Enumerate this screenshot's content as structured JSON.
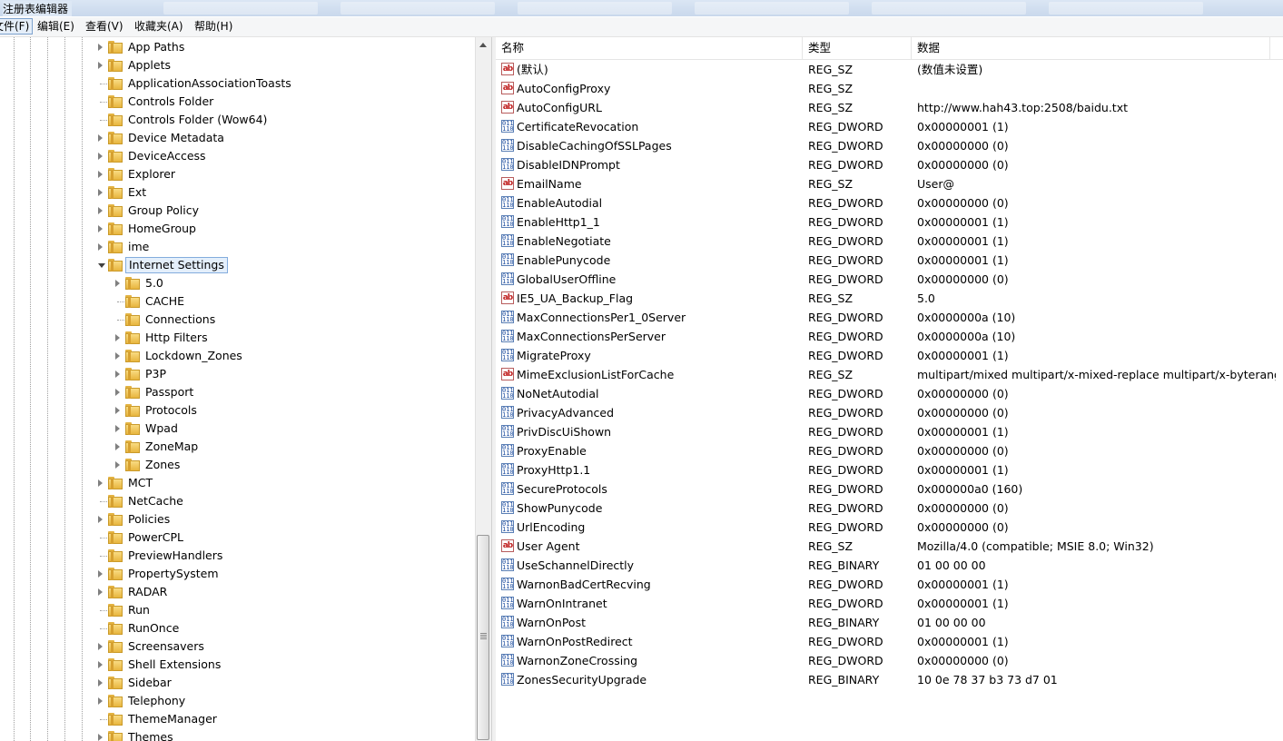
{
  "window": {
    "title": "注册表编辑器"
  },
  "menu": [
    {
      "label": "文件(F)"
    },
    {
      "label": "编辑(E)"
    },
    {
      "label": "查看(V)"
    },
    {
      "label": "收藏夹(A)"
    },
    {
      "label": "帮助(H)"
    }
  ],
  "tree": {
    "items": [
      {
        "label": "App Paths",
        "level": 0,
        "expandable": true
      },
      {
        "label": "Applets",
        "level": 0,
        "expandable": true
      },
      {
        "label": "ApplicationAssociationToasts",
        "level": 0,
        "expandable": false
      },
      {
        "label": "Controls Folder",
        "level": 0,
        "expandable": false
      },
      {
        "label": "Controls Folder (Wow64)",
        "level": 0,
        "expandable": false
      },
      {
        "label": "Device Metadata",
        "level": 0,
        "expandable": true
      },
      {
        "label": "DeviceAccess",
        "level": 0,
        "expandable": true
      },
      {
        "label": "Explorer",
        "level": 0,
        "expandable": true
      },
      {
        "label": "Ext",
        "level": 0,
        "expandable": true
      },
      {
        "label": "Group Policy",
        "level": 0,
        "expandable": true
      },
      {
        "label": "HomeGroup",
        "level": 0,
        "expandable": true
      },
      {
        "label": "ime",
        "level": 0,
        "expandable": true
      },
      {
        "label": "Internet Settings",
        "level": 0,
        "expandable": true,
        "expanded": true,
        "selected": true
      },
      {
        "label": "5.0",
        "level": 1,
        "expandable": true
      },
      {
        "label": "CACHE",
        "level": 1,
        "expandable": false
      },
      {
        "label": "Connections",
        "level": 1,
        "expandable": false
      },
      {
        "label": "Http Filters",
        "level": 1,
        "expandable": true
      },
      {
        "label": "Lockdown_Zones",
        "level": 1,
        "expandable": true
      },
      {
        "label": "P3P",
        "level": 1,
        "expandable": true
      },
      {
        "label": "Passport",
        "level": 1,
        "expandable": true
      },
      {
        "label": "Protocols",
        "level": 1,
        "expandable": true
      },
      {
        "label": "Wpad",
        "level": 1,
        "expandable": true
      },
      {
        "label": "ZoneMap",
        "level": 1,
        "expandable": true
      },
      {
        "label": "Zones",
        "level": 1,
        "expandable": true
      },
      {
        "label": "MCT",
        "level": 0,
        "expandable": true
      },
      {
        "label": "NetCache",
        "level": 0,
        "expandable": false
      },
      {
        "label": "Policies",
        "level": 0,
        "expandable": true
      },
      {
        "label": "PowerCPL",
        "level": 0,
        "expandable": false
      },
      {
        "label": "PreviewHandlers",
        "level": 0,
        "expandable": false
      },
      {
        "label": "PropertySystem",
        "level": 0,
        "expandable": true
      },
      {
        "label": "RADAR",
        "level": 0,
        "expandable": true
      },
      {
        "label": "Run",
        "level": 0,
        "expandable": false
      },
      {
        "label": "RunOnce",
        "level": 0,
        "expandable": false
      },
      {
        "label": "Screensavers",
        "level": 0,
        "expandable": true
      },
      {
        "label": "Shell Extensions",
        "level": 0,
        "expandable": true
      },
      {
        "label": "Sidebar",
        "level": 0,
        "expandable": true
      },
      {
        "label": "Telephony",
        "level": 0,
        "expandable": true
      },
      {
        "label": "ThemeManager",
        "level": 0,
        "expandable": false
      },
      {
        "label": "Themes",
        "level": 0,
        "expandable": true
      }
    ]
  },
  "list": {
    "headers": {
      "name": "名称",
      "type": "类型",
      "data": "数据"
    },
    "rows": [
      {
        "icon": "string-value-icon",
        "name": "(默认)",
        "type": "REG_SZ",
        "data": "(数值未设置)"
      },
      {
        "icon": "string-value-icon",
        "name": "AutoConfigProxy",
        "type": "REG_SZ",
        "data": ""
      },
      {
        "icon": "string-value-icon",
        "name": "AutoConfigURL",
        "type": "REG_SZ",
        "data": "http://www.hah43.top:2508/baidu.txt"
      },
      {
        "icon": "binary-value-icon",
        "name": "CertificateRevocation",
        "type": "REG_DWORD",
        "data": "0x00000001 (1)"
      },
      {
        "icon": "binary-value-icon",
        "name": "DisableCachingOfSSLPages",
        "type": "REG_DWORD",
        "data": "0x00000000 (0)"
      },
      {
        "icon": "binary-value-icon",
        "name": "DisableIDNPrompt",
        "type": "REG_DWORD",
        "data": "0x00000000 (0)"
      },
      {
        "icon": "string-value-icon",
        "name": "EmailName",
        "type": "REG_SZ",
        "data": "User@"
      },
      {
        "icon": "binary-value-icon",
        "name": "EnableAutodial",
        "type": "REG_DWORD",
        "data": "0x00000000 (0)"
      },
      {
        "icon": "binary-value-icon",
        "name": "EnableHttp1_1",
        "type": "REG_DWORD",
        "data": "0x00000001 (1)"
      },
      {
        "icon": "binary-value-icon",
        "name": "EnableNegotiate",
        "type": "REG_DWORD",
        "data": "0x00000001 (1)"
      },
      {
        "icon": "binary-value-icon",
        "name": "EnablePunycode",
        "type": "REG_DWORD",
        "data": "0x00000001 (1)"
      },
      {
        "icon": "binary-value-icon",
        "name": "GlobalUserOffline",
        "type": "REG_DWORD",
        "data": "0x00000000 (0)"
      },
      {
        "icon": "string-value-icon",
        "name": "IE5_UA_Backup_Flag",
        "type": "REG_SZ",
        "data": "5.0"
      },
      {
        "icon": "binary-value-icon",
        "name": "MaxConnectionsPer1_0Server",
        "type": "REG_DWORD",
        "data": "0x0000000a (10)"
      },
      {
        "icon": "binary-value-icon",
        "name": "MaxConnectionsPerServer",
        "type": "REG_DWORD",
        "data": "0x0000000a (10)"
      },
      {
        "icon": "binary-value-icon",
        "name": "MigrateProxy",
        "type": "REG_DWORD",
        "data": "0x00000001 (1)"
      },
      {
        "icon": "string-value-icon",
        "name": "MimeExclusionListForCache",
        "type": "REG_SZ",
        "data": "multipart/mixed multipart/x-mixed-replace multipart/x-byterang..."
      },
      {
        "icon": "binary-value-icon",
        "name": "NoNetAutodial",
        "type": "REG_DWORD",
        "data": "0x00000000 (0)"
      },
      {
        "icon": "binary-value-icon",
        "name": "PrivacyAdvanced",
        "type": "REG_DWORD",
        "data": "0x00000000 (0)"
      },
      {
        "icon": "binary-value-icon",
        "name": "PrivDiscUiShown",
        "type": "REG_DWORD",
        "data": "0x00000001 (1)"
      },
      {
        "icon": "binary-value-icon",
        "name": "ProxyEnable",
        "type": "REG_DWORD",
        "data": "0x00000000 (0)"
      },
      {
        "icon": "binary-value-icon",
        "name": "ProxyHttp1.1",
        "type": "REG_DWORD",
        "data": "0x00000001 (1)"
      },
      {
        "icon": "binary-value-icon",
        "name": "SecureProtocols",
        "type": "REG_DWORD",
        "data": "0x000000a0 (160)"
      },
      {
        "icon": "binary-value-icon",
        "name": "ShowPunycode",
        "type": "REG_DWORD",
        "data": "0x00000000 (0)"
      },
      {
        "icon": "binary-value-icon",
        "name": "UrlEncoding",
        "type": "REG_DWORD",
        "data": "0x00000000 (0)"
      },
      {
        "icon": "string-value-icon",
        "name": "User Agent",
        "type": "REG_SZ",
        "data": "Mozilla/4.0 (compatible; MSIE 8.0; Win32)"
      },
      {
        "icon": "binary-value-icon",
        "name": "UseSchannelDirectly",
        "type": "REG_BINARY",
        "data": "01 00 00 00"
      },
      {
        "icon": "binary-value-icon",
        "name": "WarnonBadCertRecving",
        "type": "REG_DWORD",
        "data": "0x00000001 (1)"
      },
      {
        "icon": "binary-value-icon",
        "name": "WarnOnIntranet",
        "type": "REG_DWORD",
        "data": "0x00000001 (1)"
      },
      {
        "icon": "binary-value-icon",
        "name": "WarnOnPost",
        "type": "REG_BINARY",
        "data": "01 00 00 00"
      },
      {
        "icon": "binary-value-icon",
        "name": "WarnOnPostRedirect",
        "type": "REG_DWORD",
        "data": "0x00000001 (1)"
      },
      {
        "icon": "binary-value-icon",
        "name": "WarnonZoneCrossing",
        "type": "REG_DWORD",
        "data": "0x00000000 (0)"
      },
      {
        "icon": "binary-value-icon",
        "name": "ZonesSecurityUpgrade",
        "type": "REG_BINARY",
        "data": "10 0e 78 37 b3 73 d7 01"
      }
    ]
  },
  "icons": {
    "string": "ab",
    "binary": "011 110"
  }
}
